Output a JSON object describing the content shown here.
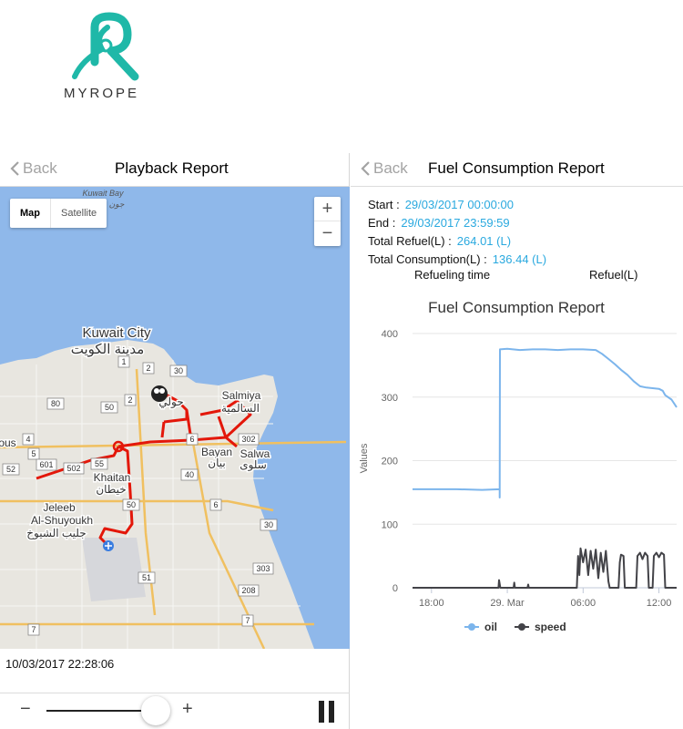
{
  "logo": {
    "text": "MYROPE",
    "color": "#1fb8a8"
  },
  "playback": {
    "back_label": "Back",
    "title": "Playback Report",
    "map_type": {
      "map_label": "Map",
      "satellite_label": "Satellite",
      "selected": "Map"
    },
    "zoom_in": "+",
    "zoom_out": "−",
    "timestamp": "10/03/2017 22:28:06",
    "controls": {
      "minus": "−",
      "plus": "+",
      "pause_icon": "pause-icon"
    },
    "route_color": "#e3170a",
    "map_labels": {
      "kuwait_bay": "Kuwait Bay",
      "kuwait_bay_ar": "جون",
      "kuwait_city": "Kuwait City",
      "kuwait_city_ar": "مدينة الكويت",
      "salmiya": "Salmiya",
      "salmiya_ar": "السالمية",
      "bayan": "Bayan",
      "bayan_ar": "بيان",
      "salwa": "Salwa",
      "salwa_ar": "سلوى",
      "khaitan": "Khaitan",
      "khaitan_ar": "خيطان",
      "jeleeb1": "Jeleeb",
      "jeleeb2": "Al-Shuyoukh",
      "jeleeb_ar": "جليب الشيوخ",
      "hawally_ar": "حولي",
      "ous": "ous",
      "road_1": "1",
      "road_2": "2",
      "road_30a": "30",
      "road_50a": "50",
      "road_80": "80",
      "road_4": "4",
      "road_5": "5",
      "road_601": "601",
      "road_502": "502",
      "road_55": "55",
      "road_52": "52",
      "road_6": "6",
      "road_302": "302",
      "road_40": "40",
      "road_50b": "50",
      "road_30b": "30",
      "road_303": "303",
      "road_51": "51",
      "road_208": "208",
      "road_7a": "7",
      "road_7b": "7"
    }
  },
  "fuel": {
    "back_label": "Back",
    "title": "Fuel Consumption Report",
    "start_label": "Start :",
    "start_value": "29/03/2017 00:00:00",
    "end_label": "End :",
    "end_value": "29/03/2017 23:59:59",
    "refuel_label": "Total Refuel(L) :",
    "refuel_value": "264.01 (L)",
    "consumption_label": "Total Consumption(L) :",
    "consumption_value": "136.44 (L)",
    "col_time": "Refueling time",
    "col_refuel": "Refuel(L)",
    "value_color": "#2aa9df"
  },
  "chart_data": {
    "type": "line",
    "title": "Fuel Consumption Report",
    "ylabel": "Values",
    "xlabel": "",
    "ylim": [
      0,
      400
    ],
    "yticks": [
      0,
      100,
      200,
      300,
      400
    ],
    "xlim": [
      16.5,
      37.4
    ],
    "xticks": [
      {
        "x": 18,
        "label": "18:00"
      },
      {
        "x": 24,
        "label": "29. Mar"
      },
      {
        "x": 30,
        "label": "06:00"
      },
      {
        "x": 36,
        "label": "12:00"
      }
    ],
    "grid": true,
    "legend": "bottom",
    "series": [
      {
        "name": "oil",
        "color": "#7cb5ec",
        "points": [
          [
            16.5,
            155
          ],
          [
            18,
            155
          ],
          [
            20,
            155
          ],
          [
            22,
            154
          ],
          [
            23.4,
            155
          ],
          [
            23.4,
            142
          ],
          [
            23.42,
            375
          ],
          [
            24,
            376
          ],
          [
            25,
            374
          ],
          [
            26,
            375
          ],
          [
            27,
            375
          ],
          [
            28,
            374
          ],
          [
            29,
            375
          ],
          [
            30,
            375
          ],
          [
            31,
            374
          ],
          [
            31.5,
            368
          ],
          [
            32,
            360
          ],
          [
            32.5,
            352
          ],
          [
            33,
            343
          ],
          [
            33.5,
            335
          ],
          [
            34,
            325
          ],
          [
            34.5,
            317
          ],
          [
            35,
            315
          ],
          [
            36,
            313
          ],
          [
            36.3,
            310
          ],
          [
            36.5,
            303
          ],
          [
            37,
            296
          ],
          [
            37.2,
            290
          ],
          [
            37.4,
            284
          ]
        ]
      },
      {
        "name": "speed",
        "color": "#434348",
        "points": [
          [
            16.5,
            0
          ],
          [
            23.3,
            0
          ],
          [
            23.35,
            12
          ],
          [
            23.45,
            0
          ],
          [
            24.5,
            0
          ],
          [
            24.55,
            8
          ],
          [
            24.6,
            0
          ],
          [
            25.6,
            0
          ],
          [
            25.65,
            5
          ],
          [
            25.7,
            0
          ],
          [
            29.5,
            0
          ],
          [
            29.6,
            50
          ],
          [
            29.7,
            20
          ],
          [
            29.8,
            62
          ],
          [
            30,
            40
          ],
          [
            30.2,
            60
          ],
          [
            30.4,
            20
          ],
          [
            30.6,
            58
          ],
          [
            30.8,
            30
          ],
          [
            31,
            60
          ],
          [
            31.2,
            15
          ],
          [
            31.4,
            55
          ],
          [
            31.6,
            25
          ],
          [
            31.8,
            58
          ],
          [
            32,
            10
          ],
          [
            32.1,
            0
          ],
          [
            32.8,
            0
          ],
          [
            32.9,
            40
          ],
          [
            33,
            52
          ],
          [
            33.2,
            50
          ],
          [
            33.3,
            0
          ],
          [
            34.2,
            0
          ],
          [
            34.3,
            50
          ],
          [
            34.5,
            55
          ],
          [
            34.7,
            45
          ],
          [
            34.9,
            55
          ],
          [
            35.1,
            50
          ],
          [
            35.2,
            0
          ],
          [
            35.5,
            0
          ],
          [
            35.6,
            50
          ],
          [
            35.8,
            55
          ],
          [
            36,
            48
          ],
          [
            36.2,
            55
          ],
          [
            36.4,
            52
          ],
          [
            36.5,
            0
          ],
          [
            37.4,
            0
          ]
        ]
      }
    ]
  }
}
